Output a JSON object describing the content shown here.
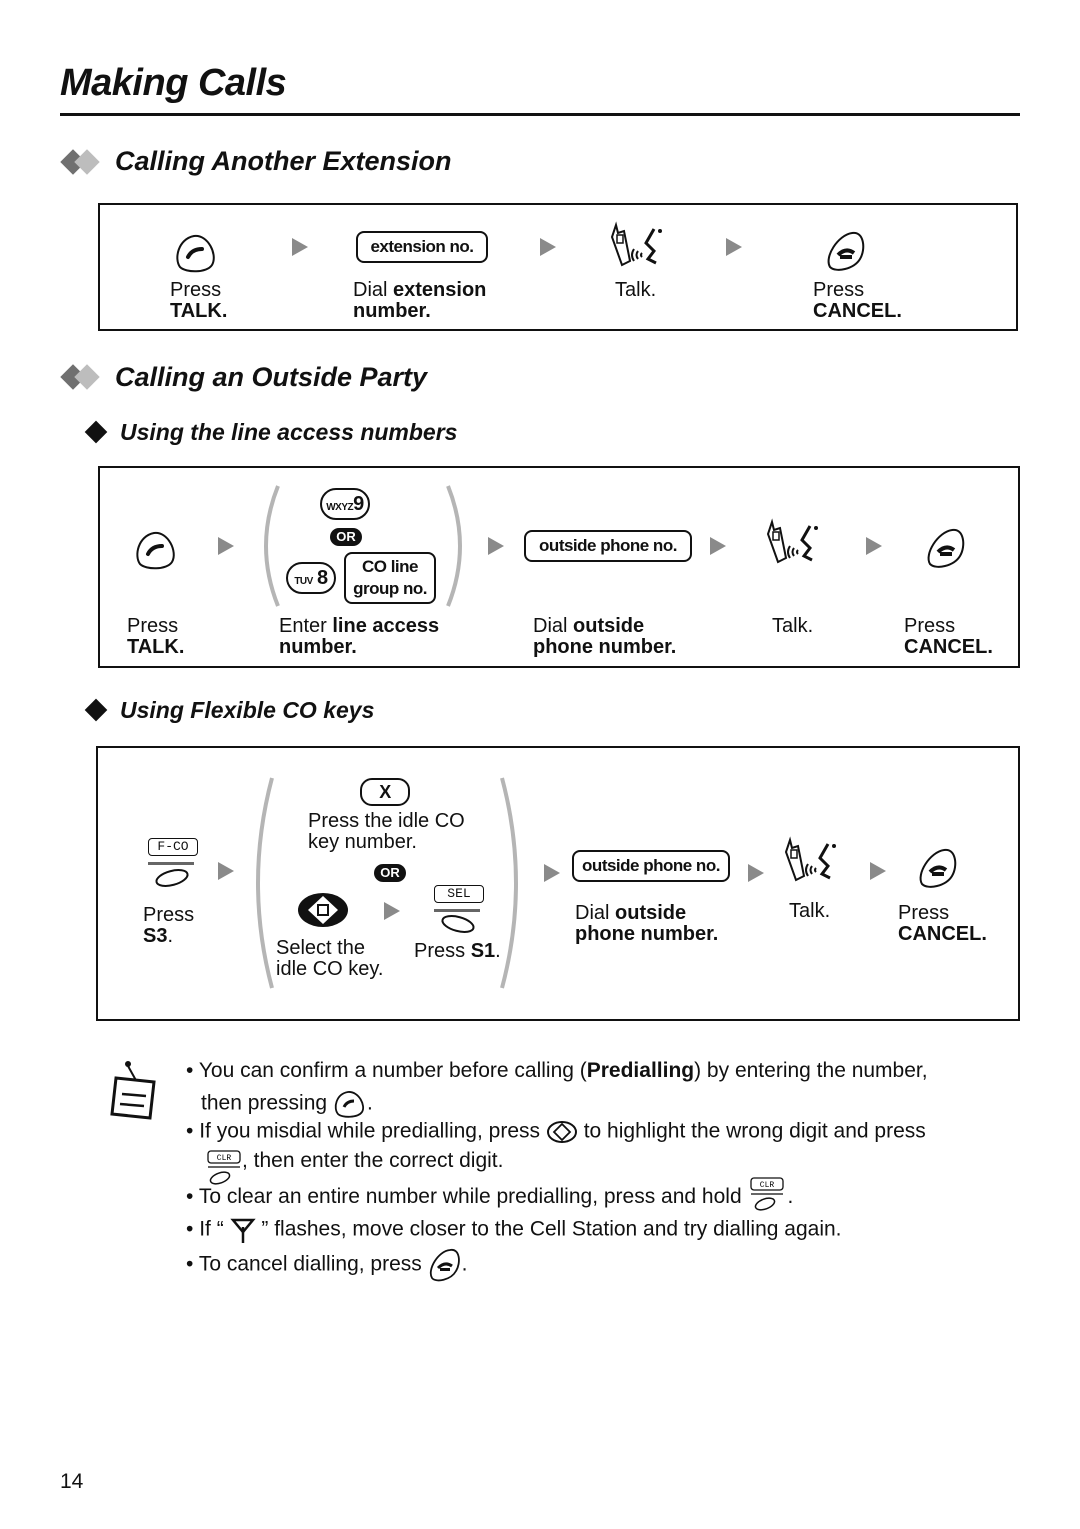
{
  "page": {
    "title": "Making Calls",
    "page_number": "14"
  },
  "section_extension": {
    "heading": "Calling Another Extension",
    "steps": [
      {
        "icon": "talk-button-icon",
        "text_plain": "Press",
        "text_bold": "TALK."
      },
      {
        "icon": "extension-no-key",
        "key_label": "extension no.",
        "text_plain": "Dial ",
        "text_bold_1": "extension",
        "text_bold_2": "number."
      },
      {
        "icon": "talking-handset-icon",
        "text_plain": "Talk."
      },
      {
        "icon": "cancel-button-icon",
        "text_plain": "Press",
        "text_bold": "CANCEL."
      }
    ]
  },
  "section_outside": {
    "heading": "Calling an Outside Party",
    "line_access": {
      "heading": "Using the line access numbers",
      "key_9": {
        "letters": "WXYZ",
        "digit": "9"
      },
      "or_label": "OR",
      "key_8": {
        "letters": "TUV",
        "digit": "8"
      },
      "co_line_key": {
        "line1": "CO line",
        "line2": "group no."
      },
      "phone_key": "outside phone no.",
      "steps": [
        {
          "text_plain": "Press",
          "text_bold": "TALK."
        },
        {
          "text_plain": "Enter ",
          "text_bold_1": "line access",
          "text_bold_2": "number."
        },
        {
          "text_plain": "Dial ",
          "text_bold_1": "outside",
          "text_bold_2": "phone number."
        },
        {
          "text_plain": "Talk."
        },
        {
          "text_plain": "Press",
          "text_bold": "CANCEL."
        }
      ]
    },
    "flexible_co": {
      "heading": "Using Flexible CO keys",
      "fco_softkey": "F-CO",
      "x_key": "X",
      "idle_co_text_1": "Press the idle CO",
      "idle_co_text_2": "key number.",
      "or_label": "OR",
      "sel_softkey": "SEL",
      "select_text_1": "Select the",
      "select_text_2": "idle CO key.",
      "press_s1_plain": "Press ",
      "press_s1_bold": "S1",
      "press_s1_end": ".",
      "press_s3_plain": "Press",
      "press_s3_bold": "S3",
      "press_s3_end": ".",
      "phone_key": "outside phone no.",
      "dial_plain": "Dial ",
      "dial_bold_1": "outside",
      "dial_bold_2": "phone number.",
      "talk": "Talk.",
      "cancel_plain": "Press",
      "cancel_bold": "CANCEL."
    }
  },
  "notes": {
    "items": [
      {
        "part1": "You can confirm a number before calling (",
        "bold": "Predialling",
        "part2": ") by entering the number,",
        "line2": "then pressing",
        "line2_end": "."
      },
      {
        "part1": "If you misdial while predialling, press",
        "part2": "to highlight the wrong digit and press",
        "line2": ", then enter the correct digit."
      },
      {
        "part1": "To clear an entire number while predialling, press and hold",
        "end": "."
      },
      {
        "part1": "If “",
        "part2": "” flashes, move closer to the Cell Station and try dialling again."
      },
      {
        "part1": "To cancel dialling, press",
        "end": "."
      }
    ],
    "clr_label": "CLR"
  }
}
